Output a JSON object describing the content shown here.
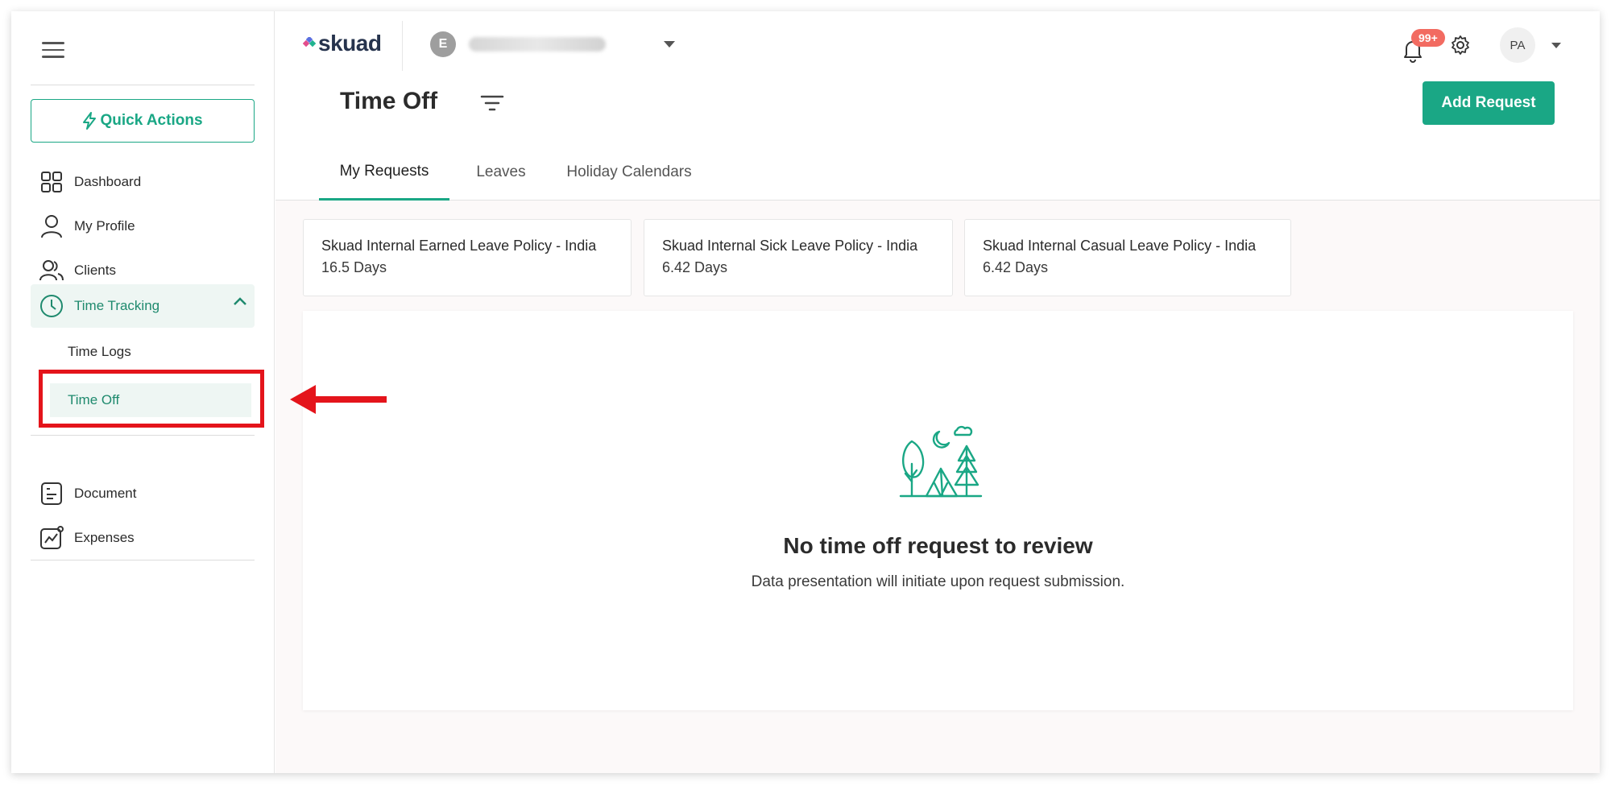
{
  "sidebar": {
    "quick_actions": "Quick Actions",
    "items": [
      {
        "label": "Dashboard",
        "icon": "grid-icon"
      },
      {
        "label": "My Profile",
        "icon": "user-icon"
      },
      {
        "label": "Clients",
        "icon": "users-icon"
      },
      {
        "label": "Time Tracking",
        "icon": "clock-icon"
      },
      {
        "label": "Document",
        "icon": "document-icon"
      },
      {
        "label": "Expenses",
        "icon": "chart-icon"
      }
    ],
    "subitems": [
      {
        "label": "Time Logs"
      },
      {
        "label": "Time Off"
      }
    ]
  },
  "topbar": {
    "logo": "skuad",
    "account_initial": "E",
    "notification_count": "99+",
    "avatar_initials": "PA"
  },
  "page": {
    "title": "Time Off",
    "add_request": "Add Request"
  },
  "tabs": [
    {
      "label": "My Requests"
    },
    {
      "label": "Leaves"
    },
    {
      "label": "Holiday Calendars"
    }
  ],
  "policies": [
    {
      "name": "Skuad Internal Earned Leave Policy - India",
      "days": "16.5 Days"
    },
    {
      "name": "Skuad Internal Sick Leave Policy - India",
      "days": "6.42 Days"
    },
    {
      "name": "Skuad Internal Casual Leave Policy - India",
      "days": "6.42 Days"
    }
  ],
  "empty_state": {
    "title": "No time off request to review",
    "subtitle": "Data presentation will initiate upon request submission."
  },
  "colors": {
    "accent": "#1aa785",
    "highlight": "#e4141b",
    "badge": "#f26b61"
  }
}
